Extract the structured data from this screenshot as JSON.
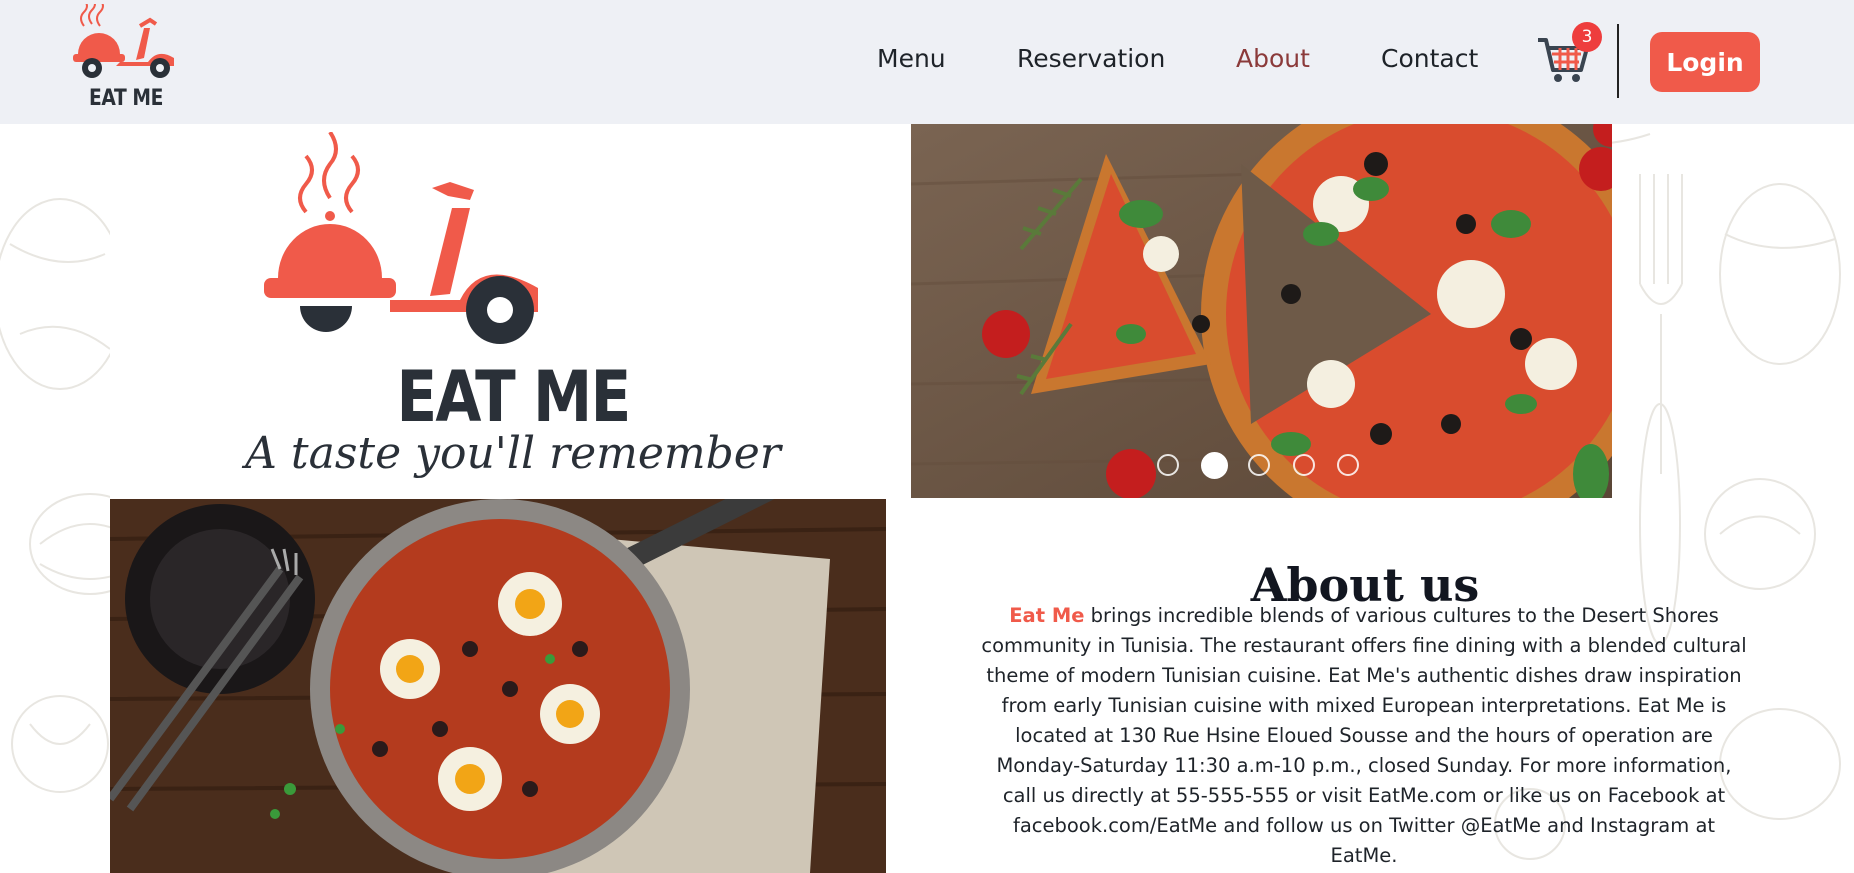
{
  "header": {
    "logo_text": "EAT ME",
    "nav": [
      {
        "label": "Menu"
      },
      {
        "label": "Reservation"
      },
      {
        "label": "About",
        "active": true
      },
      {
        "label": "Contact"
      }
    ],
    "cart": {
      "icon": "shopping-cart-icon",
      "count": "3"
    },
    "login_label": "Login"
  },
  "brand": {
    "title": "EAT ME",
    "tagline": "A taste you'll remember"
  },
  "slider": {
    "image": "pizza-photo",
    "active_index": 2,
    "slide_count": 5
  },
  "about": {
    "title": "About us",
    "brand_name": "Eat Me",
    "body": " brings incredible blends of various cultures to the Desert Shores community in Tunisia. The restaurant offers fine dining with a blended cultural theme of modern Tunisian cuisine. Eat Me's authentic dishes draw inspiration from early Tunisian cuisine with mixed European interpretations. Eat Me is located at 130 Rue Hsine Eloued Sousse and the hours of operation are Monday-Saturday 11:30 a.m-10 p.m., closed Sunday. For more information, call us directly at 55-555-555 or visit EatMe.com or like us on Facebook at facebook.com/EatMe and follow us on Twitter @EatMe and Instagram at EatMe."
  },
  "colors": {
    "accent": "#f05a4a",
    "active_nav": "#8b3a3a",
    "header_bg": "#eef0f5",
    "dark": "#2a3038",
    "badge": "#ee3d3d"
  }
}
